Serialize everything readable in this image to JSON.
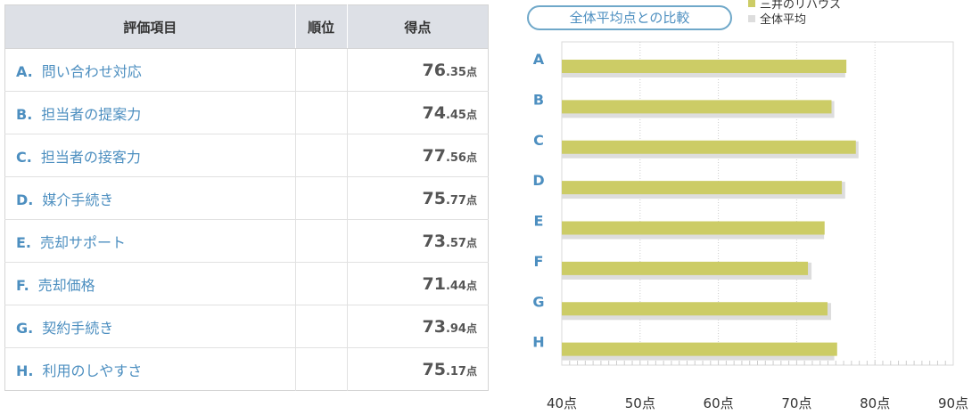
{
  "table": {
    "headers": {
      "item": "評価項目",
      "rank": "順位",
      "score": "得点"
    },
    "unit": "点",
    "rows": [
      {
        "letter": "A.",
        "label": "問い合わせ対応",
        "int": "76",
        "dec": ".35",
        "rank": ""
      },
      {
        "letter": "B.",
        "label": "担当者の提案力",
        "int": "74",
        "dec": ".45",
        "rank": ""
      },
      {
        "letter": "C.",
        "label": "担当者の接客力",
        "int": "77",
        "dec": ".56",
        "rank": ""
      },
      {
        "letter": "D.",
        "label": "媒介手続き",
        "int": "75",
        "dec": ".77",
        "rank": ""
      },
      {
        "letter": "E.",
        "label": "売却サポート",
        "int": "73",
        "dec": ".57",
        "rank": ""
      },
      {
        "letter": "F.",
        "label": "売却価格",
        "int": "71",
        "dec": ".44",
        "rank": ""
      },
      {
        "letter": "G.",
        "label": "契約手続き",
        "int": "73",
        "dec": ".94",
        "rank": ""
      },
      {
        "letter": "H.",
        "label": "利用のしやすさ",
        "int": "75",
        "dec": ".17",
        "rank": ""
      }
    ]
  },
  "compare_label": "全体平均点との比較",
  "chart_data": {
    "type": "bar",
    "orientation": "horizontal",
    "categories": [
      "A",
      "B",
      "C",
      "D",
      "E",
      "F",
      "G",
      "H"
    ],
    "series": [
      {
        "name": "三井のリハウス",
        "color": "#cccc66",
        "values": [
          76.35,
          74.45,
          77.56,
          75.77,
          73.57,
          71.44,
          73.94,
          75.17
        ]
      },
      {
        "name": "全体平均",
        "color": "#dddddd",
        "values": [
          76.2,
          74.8,
          77.9,
          76.2,
          73.5,
          71.9,
          74.4,
          74.8
        ]
      }
    ],
    "xlim": [
      40,
      90
    ],
    "xticks": [
      "40点",
      "50点",
      "60点",
      "70点",
      "80点",
      "90点"
    ],
    "grid": true,
    "legend_position": "top-right"
  }
}
